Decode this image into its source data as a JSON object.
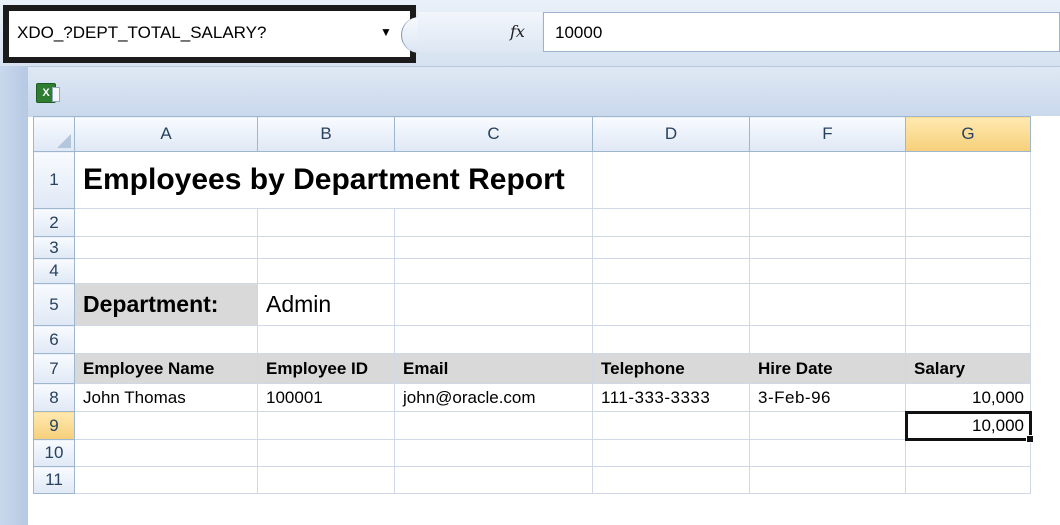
{
  "formula_bar": {
    "name_box": "XDO_?DEPT_TOTAL_SALARY?",
    "fx_label": "fx",
    "formula_value": "10000"
  },
  "sheet": {
    "columns": [
      "A",
      "B",
      "C",
      "D",
      "F",
      "G"
    ],
    "selected_column": "G",
    "rows": [
      "1",
      "2",
      "3",
      "4",
      "5",
      "6",
      "7",
      "8",
      "9",
      "10",
      "11"
    ],
    "selected_row": "9",
    "cells": {
      "title": "Employees by Department Report",
      "department_label": "Department:",
      "department_value": "Admin",
      "headers": [
        "Employee Name",
        "Employee ID",
        "Email",
        "Telephone",
        "Hire Date",
        "Salary"
      ],
      "row8": [
        "John Thomas",
        "100001",
        "john@oracle.com",
        "111-333-3333",
        "3-Feb-96",
        "10,000"
      ],
      "total_salary": "10,000"
    }
  }
}
